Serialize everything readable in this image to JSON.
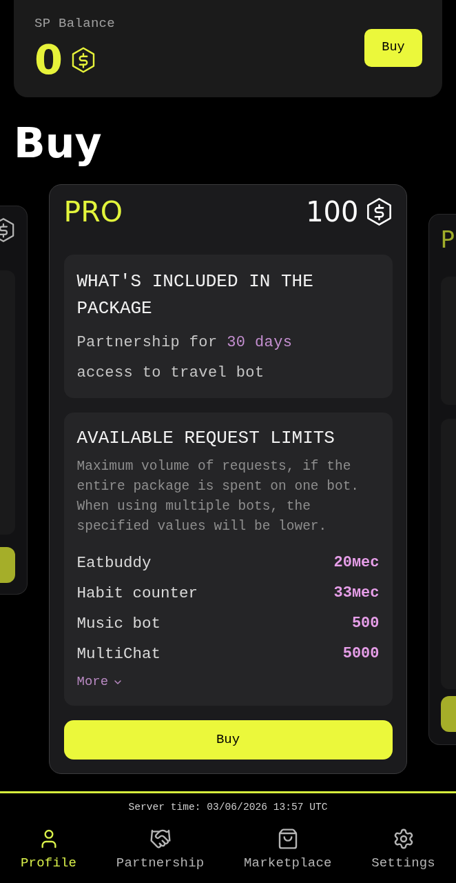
{
  "balance_card": {
    "label": "SP Balance",
    "amount": "0",
    "button": "Buy"
  },
  "section_title": "Buy",
  "packages": [
    {
      "kind": "peek_left",
      "selected": false
    },
    {
      "kind": "full",
      "selected": true,
      "title": "PRO",
      "price": "100",
      "included": {
        "heading": "WHAT'S INCLUDED IN THE PACKAGE",
        "items": [
          {
            "text": "Partnership for",
            "highlight": "30 days"
          },
          {
            "text": "access to travel bot"
          }
        ]
      },
      "limits": {
        "heading": "AVAILABLE REQUEST LIMITS",
        "description": "Maximum volume of requests, if the entire package is spent on one bot. When using multiple bots, the specified values will be lower.",
        "rows": [
          {
            "name": "Eatbuddy",
            "value": "20мес"
          },
          {
            "name": "Habit counter",
            "value": "33мес"
          },
          {
            "name": "Music bot",
            "value": "500"
          },
          {
            "name": "MultiChat",
            "value": "5000"
          }
        ],
        "more": {
          "label": "More",
          "expanded": false
        }
      },
      "button": "Buy"
    },
    {
      "kind": "peek_right",
      "selected": false,
      "title": "P"
    }
  ],
  "footer": {
    "server_time": "Server time: 03/06/2026 13:57 UTC"
  },
  "nav": [
    {
      "label": "Profile",
      "selected": true
    },
    {
      "label": "Partnership",
      "selected": false
    },
    {
      "label": "Marketplace",
      "selected": false
    },
    {
      "label": "Settings",
      "selected": false
    }
  ]
}
